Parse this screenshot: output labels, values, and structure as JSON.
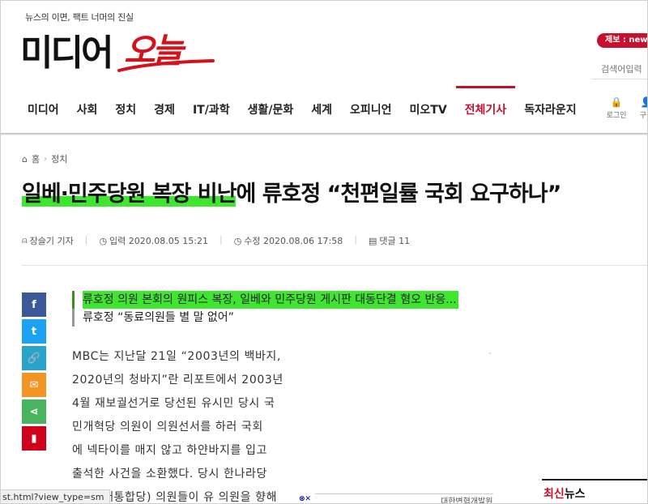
{
  "header": {
    "tagline": "뉴스의 이면, 팩트 너머의 진실",
    "logo_dark": "미디어",
    "logo_red": "오늘",
    "jebo": "제보 : news",
    "search_placeholder": "검색어입력",
    "login_label": "로그인",
    "join_label": "구독",
    "nav": [
      "미디어",
      "사회",
      "정치",
      "경제",
      "IT/과학",
      "생활/문화",
      "세계",
      "오피니언",
      "미오TV",
      "전체기사",
      "독자라운지"
    ],
    "active_nav": "전체기사"
  },
  "breadcrumb": {
    "home": "홈",
    "section": "정치"
  },
  "article": {
    "headline_highlighted": "일베·민주당원 복장 비난",
    "headline_rest": "에 류호정 “천편일률 국회 요구하나”",
    "author": "장슬기 기자",
    "input_time": "입력 2020.08.05 15:21",
    "edit_time": "수정 2020.08.06 17:58",
    "comments": "댓글 11",
    "subheads": [
      "류호정 의원 본회의 원피스 복장, 일베와 민주당원 게시판 대동단결 혐오 반응...",
      "류호정 “동료의원들 별 말 없어”"
    ],
    "body_lines": [
      "MBC는 지난달 21일 “2003년의 백바지,",
      "2020년의 청바지”란 리포트에서 2003년",
      "4월 재보궐선거로 당선된 유시민 당시 국",
      "민개혁당 의원이 의원선서를 하러 국회",
      "에 넥타이를 매지 않고 하얀바지를 입고",
      "출석한 사건을 소환했다. 당시 한나라당",
      "(현 미래통합당) 의원들이 유 의원을 향해"
    ]
  },
  "share": {
    "facebook": "f",
    "twitter": "t",
    "link": "🔗",
    "mail": "✉",
    "share": "⋖",
    "bookmark": "▮"
  },
  "sidebar": {
    "latest_red": "최신",
    "latest_rest": "뉴스",
    "ad_text": "대한변협개발원"
  },
  "status_url": "st.html?view_type=sm",
  "colors": {
    "brand_red": "#c8102e",
    "highlight_green": "#3ee630"
  }
}
